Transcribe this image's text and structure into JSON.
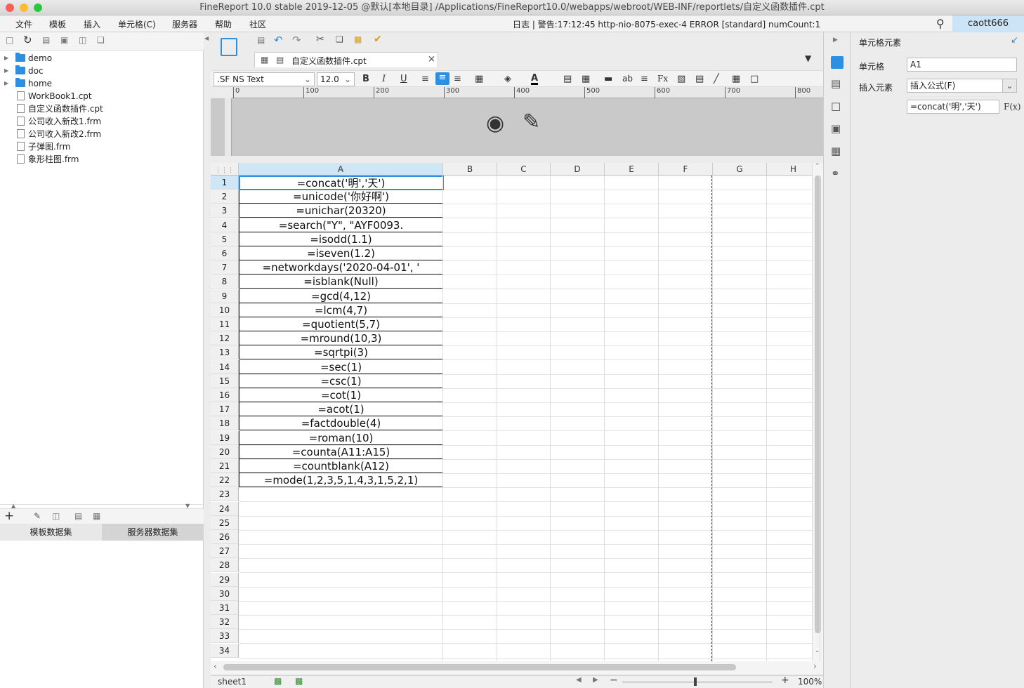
{
  "window": {
    "title": "FineReport 10.0 stable 2019-12-05 @默认[本地目录]    /Applications/FineReport10.0/webapps/webroot/WEB-INF/reportlets/自定义函数插件.cpt"
  },
  "menubar": {
    "items": [
      "文件",
      "模板",
      "插入",
      "单元格(C)",
      "服务器",
      "帮助",
      "社区"
    ],
    "status": "日志 | 警告:17:12:45 http-nio-8075-exec-4 ERROR [standard]  numCount:1",
    "user": "caott666"
  },
  "file_tree": {
    "folders": [
      "demo",
      "doc",
      "home"
    ],
    "files": [
      "WorkBook1.cpt",
      "自定义函数插件.cpt",
      "公司收入新改1.frm",
      "公司收入新改2.frm",
      "子弹图.frm",
      "象形柱图.frm"
    ]
  },
  "dataset_tabs": {
    "template": "模板数据集",
    "server": "服务器数据集"
  },
  "editor": {
    "tab_label": "自定义函数插件.cpt",
    "font_name": ".SF NS Text",
    "font_size": "12.0",
    "ruler_ticks": [
      "0",
      "100",
      "200",
      "300",
      "400",
      "500",
      "600",
      "700",
      "800"
    ],
    "columns": [
      "A",
      "B",
      "C",
      "D",
      "E",
      "F",
      "G",
      "H"
    ],
    "rows": [
      "1",
      "2",
      "3",
      "4",
      "5",
      "6",
      "7",
      "8",
      "9",
      "10",
      "11",
      "12",
      "13",
      "14",
      "15",
      "16",
      "17",
      "18",
      "19",
      "20",
      "21",
      "22",
      "23",
      "24",
      "25",
      "26",
      "27",
      "28",
      "29",
      "30",
      "31",
      "32",
      "33",
      "34"
    ],
    "cells_A": [
      "=concat('明','天')",
      "=unicode('你好啊')",
      "=unichar(20320)",
      "=search(\"Y\", \"AYF0093.",
      "=isodd(1.1)",
      "=iseven(1.2)",
      "=networkdays('2020-04-01', '",
      "=isblank(Null)",
      "=gcd(4,12)",
      "=lcm(4,7)",
      "=quotient(5,7)",
      "=mround(10,3)",
      "=sqrtpi(3)",
      "=sec(1)",
      "=csc(1)",
      "=cot(1)",
      "=acot(1)",
      "=factdouble(4)",
      "=roman(10)",
      "=counta(A11:A15)",
      "=countblank(A12)",
      "=mode(1,2,3,5,1,4,3,1,5,2,1)"
    ],
    "sheet_name": "sheet1",
    "zoom": "100%"
  },
  "properties": {
    "header": "单元格元素",
    "cell_label": "单元格",
    "cell_value": "A1",
    "insert_label": "插入元素",
    "insert_value": "插入公式(F)",
    "formula_value": "=concat('明','天')",
    "fx": "F(x)"
  }
}
